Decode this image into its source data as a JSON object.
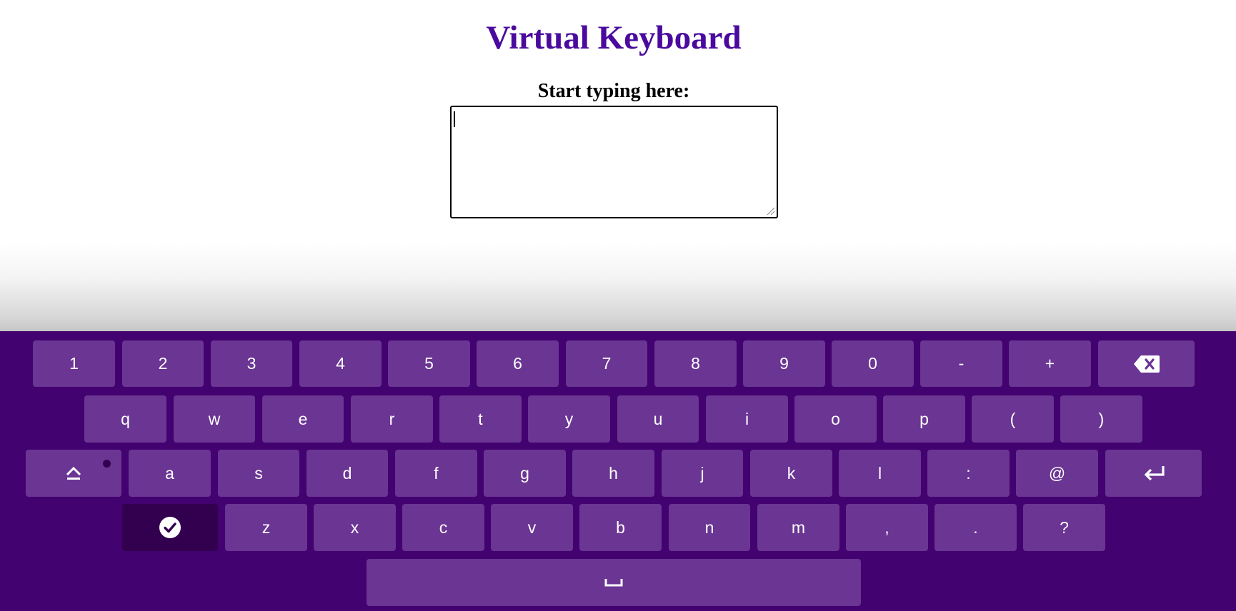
{
  "title": "Virtual Keyboard",
  "input": {
    "label": "Start typing here:",
    "value": ""
  },
  "colors": {
    "title": "#4a0a9e",
    "keyboard_bg": "#420270",
    "key_bg": "#6b3593",
    "key_active_bg": "#32004f",
    "key_text": "#ffffff"
  },
  "keyboard": {
    "row1": [
      "1",
      "2",
      "3",
      "4",
      "5",
      "6",
      "7",
      "8",
      "9",
      "0",
      "-",
      "+"
    ],
    "row2": [
      "q",
      "w",
      "e",
      "r",
      "t",
      "y",
      "u",
      "i",
      "o",
      "p",
      "(",
      ")"
    ],
    "row3": [
      "a",
      "s",
      "d",
      "f",
      "g",
      "h",
      "j",
      "k",
      "l",
      ":",
      "@"
    ],
    "row4": [
      "z",
      "x",
      "c",
      "v",
      "b",
      "n",
      "m",
      ",",
      ".",
      "?"
    ],
    "icons": {
      "backspace": "backspace-icon",
      "shift": "shift-icon",
      "enter": "enter-icon",
      "done": "check-circle-icon",
      "space": "space-icon"
    }
  }
}
